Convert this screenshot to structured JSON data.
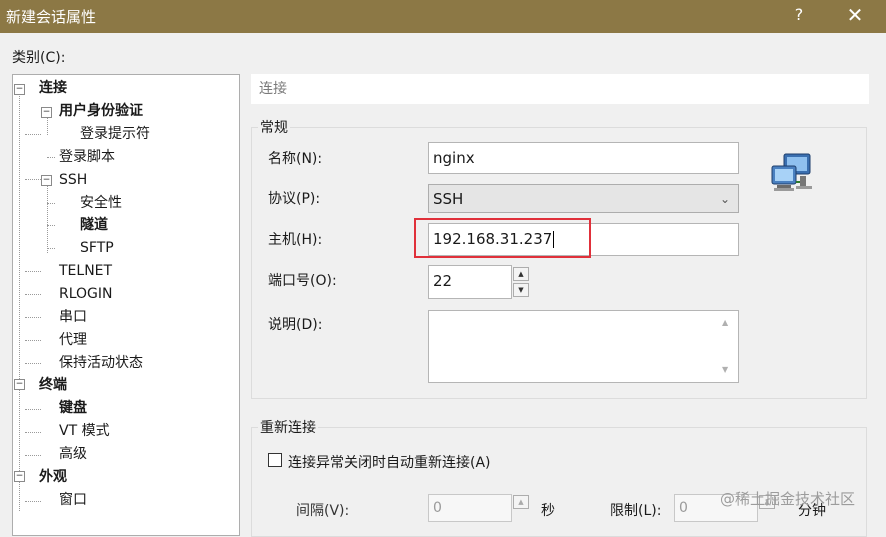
{
  "window": {
    "title": "新建会话属性",
    "help": "?",
    "close": "✕"
  },
  "category": {
    "label": "类别(C):"
  },
  "tree": {
    "items": [
      {
        "label": "连接",
        "bold": true,
        "expander": "−"
      },
      {
        "label": "用户身份验证",
        "bold": true,
        "expander": "−"
      },
      {
        "label": "登录提示符",
        "bold": false
      },
      {
        "label": "登录脚本",
        "bold": false
      },
      {
        "label": "SSH",
        "bold": false,
        "expander": "−"
      },
      {
        "label": "安全性",
        "bold": false
      },
      {
        "label": "隧道",
        "bold": true
      },
      {
        "label": "SFTP",
        "bold": false
      },
      {
        "label": "TELNET",
        "bold": false
      },
      {
        "label": "RLOGIN",
        "bold": false
      },
      {
        "label": "串口",
        "bold": false
      },
      {
        "label": "代理",
        "bold": false
      },
      {
        "label": "保持活动状态",
        "bold": false
      },
      {
        "label": "终端",
        "bold": true,
        "expander": "−"
      },
      {
        "label": "键盘",
        "bold": true
      },
      {
        "label": "VT 模式",
        "bold": false
      },
      {
        "label": "高级",
        "bold": false
      },
      {
        "label": "外观",
        "bold": true,
        "expander": "−"
      },
      {
        "label": "窗口",
        "bold": false
      }
    ]
  },
  "panel": {
    "header": "连接",
    "general": {
      "title": "常规",
      "name_label": "名称(N):",
      "name_value": "nginx",
      "protocol_label": "协议(P):",
      "protocol_value": "SSH",
      "host_label": "主机(H):",
      "host_value": "192.168.31.237",
      "port_label": "端口号(O):",
      "port_value": "22",
      "desc_label": "说明(D):",
      "desc_value": ""
    },
    "reconnect": {
      "title": "重新连接",
      "checkbox_label": "连接异常关闭时自动重新连接(A)",
      "interval_label": "间隔(V):",
      "interval_value": "0",
      "interval_unit": "秒",
      "limit_label": "限制(L):",
      "limit_value": "0",
      "limit_unit": "分钟"
    }
  },
  "watermark": "@稀土掘金技术社区",
  "icons": {
    "network": "network-computers-icon"
  }
}
